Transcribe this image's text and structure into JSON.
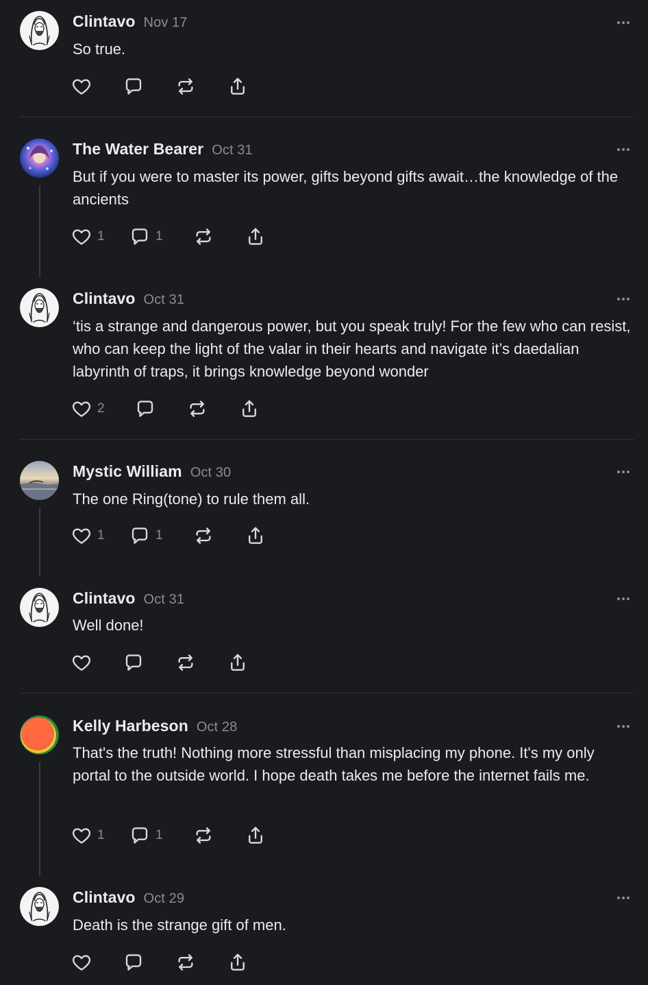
{
  "posts": [
    {
      "author": "Clintavo",
      "date": "Nov 17",
      "text": "So true.",
      "likes": "",
      "replies": ""
    },
    {
      "author": "The Water Bearer",
      "date": "Oct 31",
      "text": "But if you were to master its power, gifts beyond gifts await…the knowledge of the ancients",
      "likes": "1",
      "replies": "1"
    },
    {
      "author": "Clintavo",
      "date": "Oct 31",
      "text": "‘tis a strange and dangerous power, but you speak truly! For the few who can resist, who can keep the light of the valar in their hearts and navigate it’s daedalian labyrinth of traps, it brings knowledge beyond wonder",
      "likes": "2",
      "replies": ""
    },
    {
      "author": "Mystic William",
      "date": "Oct 30",
      "text": "The one Ring(tone) to rule them all.",
      "likes": "1",
      "replies": "1"
    },
    {
      "author": "Clintavo",
      "date": "Oct 31",
      "text": "Well done!",
      "likes": "",
      "replies": ""
    },
    {
      "author": "Kelly Harbeson",
      "date": "Oct 28",
      "text": "That's the truth! Nothing more stressful than misplacing my phone. It's my only portal to the outside world. I hope death takes me before the internet fails me.",
      "likes": "1",
      "replies": "1"
    },
    {
      "author": "Clintavo",
      "date": "Oct 29",
      "text": "Death is the strange gift of men.",
      "likes": "",
      "replies": ""
    }
  ],
  "icons": {
    "like": "heart-icon",
    "reply": "comment-icon",
    "repost": "repost-icon",
    "share": "share-icon",
    "more": "more-icon"
  },
  "colors": {
    "background": "#1a1b1e",
    "text": "#ececed",
    "muted": "#8c8d91",
    "divider": "#303135"
  }
}
